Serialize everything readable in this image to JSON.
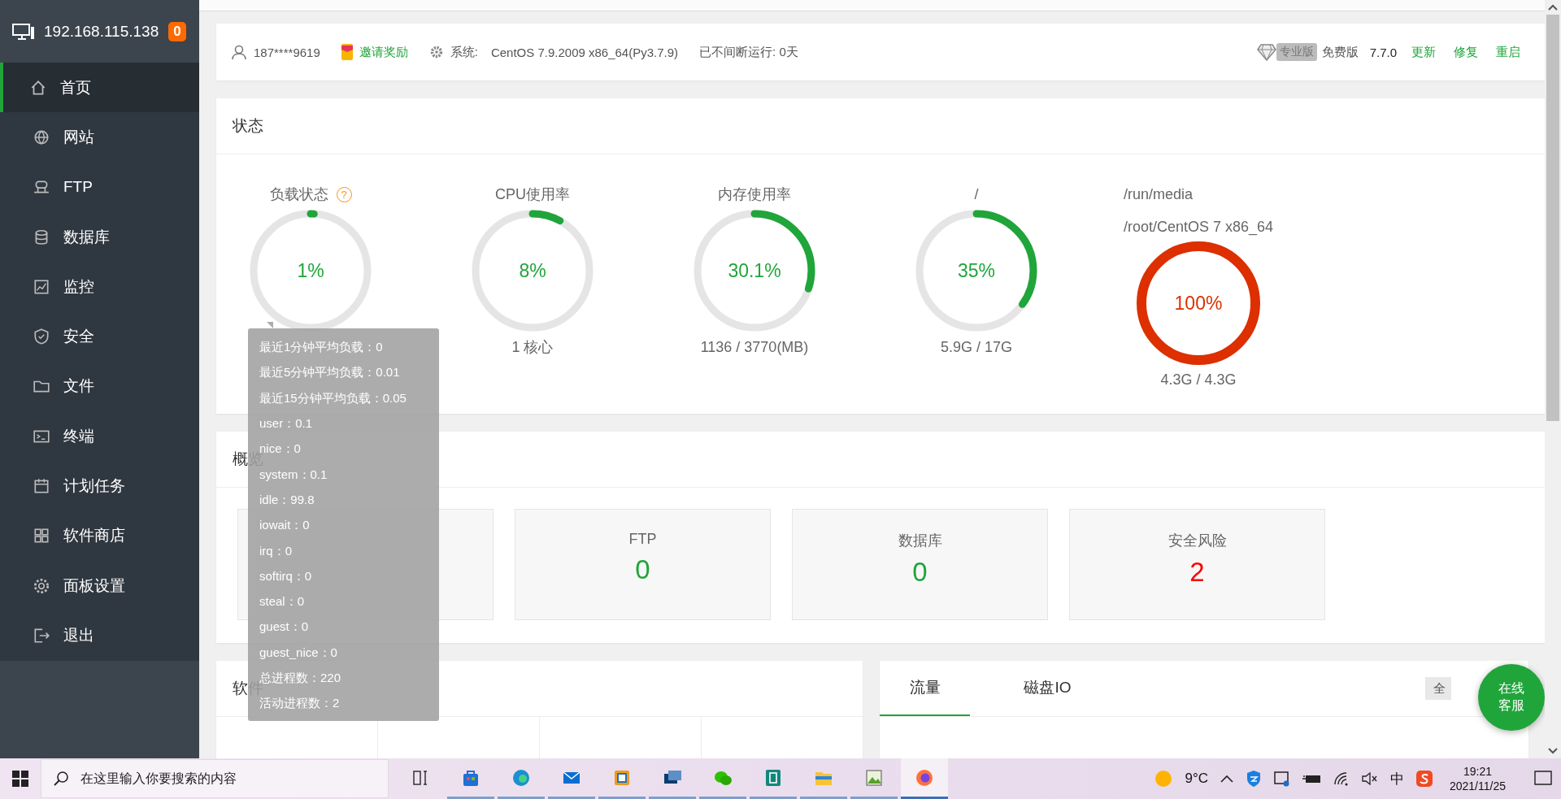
{
  "sidebar": {
    "host": "192.168.115.138",
    "badge": "0",
    "items": [
      {
        "label": "首页",
        "kind": "home",
        "selected": true
      },
      {
        "label": "网站",
        "kind": "globe",
        "selected": false
      },
      {
        "label": "FTP",
        "kind": "ftp",
        "selected": false
      },
      {
        "label": "数据库",
        "kind": "database",
        "selected": false
      },
      {
        "label": "监控",
        "kind": "chart",
        "selected": false
      },
      {
        "label": "安全",
        "kind": "shield",
        "selected": false
      },
      {
        "label": "文件",
        "kind": "folder",
        "selected": false
      },
      {
        "label": "终端",
        "kind": "terminal",
        "selected": false
      },
      {
        "label": "计划任务",
        "kind": "calendar",
        "selected": false
      },
      {
        "label": "软件商店",
        "kind": "grid",
        "selected": false
      },
      {
        "label": "面板设置",
        "kind": "gear",
        "selected": false
      },
      {
        "label": "退出",
        "kind": "exit",
        "selected": false
      }
    ]
  },
  "topbar": {
    "user": "187****9619",
    "invite": "邀请奖励",
    "system_label": "系统:",
    "system": "CentOS 7.9.2009 x86_64(Py3.7.9)",
    "uptime": "已不间断运行: 0天",
    "pro_badge": "专业版",
    "edition": "免费版",
    "version": "7.7.0",
    "links": [
      "更新",
      "修复",
      "重启"
    ]
  },
  "status": {
    "title": "状态",
    "gauges": [
      {
        "label": [
          "负载状态"
        ],
        "help": "?",
        "value": "1%",
        "level": 0.01,
        "color": "#20a53a"
      },
      {
        "label": [
          "CPU使用率"
        ],
        "value": "8%",
        "level": 0.08,
        "color": "#20a53a",
        "sub": "1 核心"
      },
      {
        "label": [
          "内存使用率"
        ],
        "value": "30.1%",
        "level": 0.301,
        "color": "#20a53a",
        "sub": "1136 / 3770(MB)"
      },
      {
        "label": [
          "/"
        ],
        "value": "35%",
        "level": 0.35,
        "color": "#20a53a",
        "sub": "5.9G / 17G"
      },
      {
        "label": [
          "/run/media",
          "/root/CentOS 7 x86_64"
        ],
        "value": "100%",
        "level": 1,
        "color": "#dd2f00",
        "sub": "4.3G / 4.3G"
      }
    ]
  },
  "load_tooltip": [
    "最近1分钟平均负载：0",
    "最近5分钟平均负载：0.01",
    "最近15分钟平均负载：0.05",
    "user：0.1",
    "nice：0",
    "system：0.1",
    "idle：99.8",
    "iowait：0",
    "irq：0",
    "softirq：0",
    "steal：0",
    "guest：0",
    "guest_nice：0",
    "总进程数：220",
    "活动进程数：2"
  ],
  "overview": {
    "title": "概览",
    "cards": [
      {
        "label": "FTP",
        "value": "0",
        "color": "#20a53a"
      },
      {
        "label": "数据库",
        "value": "0",
        "color": "#20a53a"
      },
      {
        "label": "安全风险",
        "value": "2",
        "color": "#ff0000"
      }
    ]
  },
  "software": {
    "title": "软件"
  },
  "traffic": {
    "tabs": [
      {
        "label": "流量",
        "selected": true
      },
      {
        "label": "磁盘IO",
        "selected": false
      }
    ],
    "select": "全"
  },
  "chat_button": [
    "在线",
    "客服"
  ],
  "taskbar": {
    "search_placeholder": "在这里输入你要搜索的内容",
    "apps": [
      {
        "kind": "taskview",
        "selected": false
      },
      {
        "kind": "store",
        "selected": false
      },
      {
        "kind": "edge",
        "selected": false
      },
      {
        "kind": "mail",
        "selected": false
      },
      {
        "kind": "box",
        "selected": false
      },
      {
        "kind": "monitor",
        "selected": false
      },
      {
        "kind": "chat",
        "selected": false
      },
      {
        "kind": "book",
        "selected": false
      },
      {
        "kind": "folder",
        "selected": false
      },
      {
        "kind": "paint",
        "selected": false
      },
      {
        "kind": "firefox",
        "selected": true
      }
    ],
    "temperature": "9°C",
    "ime": "中",
    "time": "19:21",
    "date": "2021/11/25"
  }
}
